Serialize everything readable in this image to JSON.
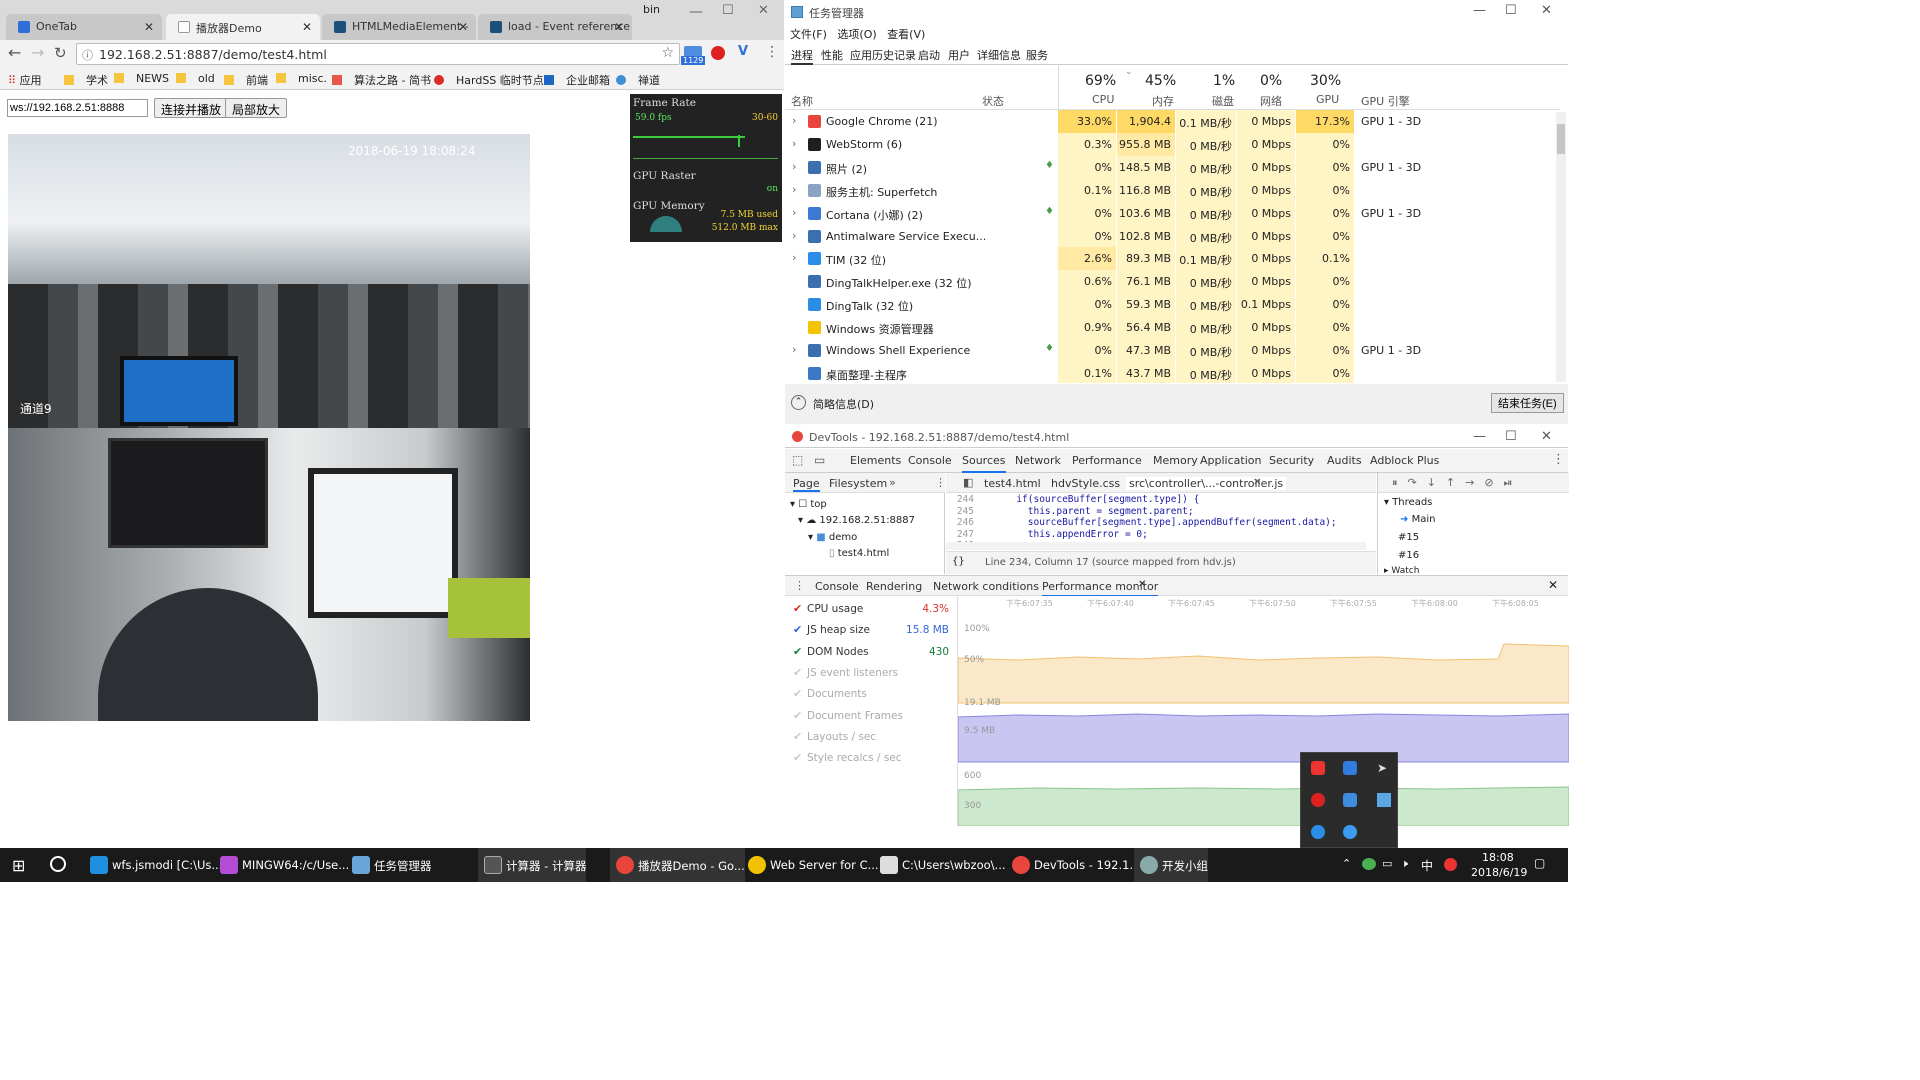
{
  "chrome": {
    "tabs": [
      {
        "label": "OneTab"
      },
      {
        "label": "播放器Demo"
      },
      {
        "label": "HTMLMediaElement -"
      },
      {
        "label": "load - Event reference"
      }
    ],
    "window_label": "bin",
    "address": "192.168.2.51:8887/demo/test4.html",
    "ext_badge": "1129",
    "bookmarks": [
      "应用",
      "学术",
      "NEWS",
      "old",
      "前端",
      "misc.",
      "算法之路 - 简书",
      "HardSS 临时节点",
      "企业邮箱",
      "禅道"
    ]
  },
  "page": {
    "ws_value": "ws://192.168.2.51:8888",
    "connect_button": "连接并播放",
    "zoom_button": "局部放大",
    "video1_timestamp": "2018-06-19 18:08:24",
    "video1_caption": "通道9"
  },
  "fps_meter": {
    "title": "Frame Rate",
    "fps": "59.0 fps",
    "range": "30-60",
    "raster_title": "GPU Raster",
    "raster_state": "on",
    "memory_title": "GPU Memory",
    "used": "7.5 MB used",
    "max": "512.0 MB max"
  },
  "task_manager": {
    "title": "任务管理器",
    "menu": [
      "文件(F)",
      "选项(O)",
      "查看(V)"
    ],
    "tabs": [
      "进程",
      "性能",
      "应用历史记录",
      "启动",
      "用户",
      "详细信息",
      "服务"
    ],
    "columns": {
      "name": "名称",
      "status": "状态",
      "cpu_pct": "69%",
      "cpu": "CPU",
      "mem_pct": "45%",
      "mem": "内存",
      "disk_pct": "1%",
      "disk": "磁盘",
      "net_pct": "0%",
      "net": "网络",
      "gpu_pct": "30%",
      "gpu": "GPU",
      "gpu_engine": "GPU 引擎"
    },
    "rows": [
      {
        "name": "Google Chrome (21)",
        "cpu": "33.0%",
        "mem": "1,904.4",
        "disk": "0.1 MB/秒",
        "net": "0 Mbps",
        "gpu": "17.3%",
        "engine": "GPU 1 - 3D"
      },
      {
        "name": "WebStorm (6)",
        "cpu": "0.3%",
        "mem": "955.8 MB",
        "disk": "0 MB/秒",
        "net": "0 Mbps",
        "gpu": "0%",
        "engine": ""
      },
      {
        "name": "照片 (2)",
        "cpu": "0%",
        "mem": "148.5 MB",
        "disk": "0 MB/秒",
        "net": "0 Mbps",
        "gpu": "0%",
        "engine": "GPU 1 - 3D"
      },
      {
        "name": "服务主机: Superfetch",
        "cpu": "0.1%",
        "mem": "116.8 MB",
        "disk": "0 MB/秒",
        "net": "0 Mbps",
        "gpu": "0%",
        "engine": ""
      },
      {
        "name": "Cortana (小娜) (2)",
        "cpu": "0%",
        "mem": "103.6 MB",
        "disk": "0 MB/秒",
        "net": "0 Mbps",
        "gpu": "0%",
        "engine": "GPU 1 - 3D"
      },
      {
        "name": "Antimalware Service Execu...",
        "cpu": "0%",
        "mem": "102.8 MB",
        "disk": "0 MB/秒",
        "net": "0 Mbps",
        "gpu": "0%",
        "engine": ""
      },
      {
        "name": "TIM (32 位)",
        "cpu": "2.6%",
        "mem": "89.3 MB",
        "disk": "0.1 MB/秒",
        "net": "0 Mbps",
        "gpu": "0.1%",
        "engine": ""
      },
      {
        "name": "DingTalkHelper.exe (32 位)",
        "cpu": "0.6%",
        "mem": "76.1 MB",
        "disk": "0 MB/秒",
        "net": "0 Mbps",
        "gpu": "0%",
        "engine": ""
      },
      {
        "name": "DingTalk (32 位)",
        "cpu": "0%",
        "mem": "59.3 MB",
        "disk": "0 MB/秒",
        "net": "0.1 Mbps",
        "gpu": "0%",
        "engine": ""
      },
      {
        "name": "Windows 资源管理器",
        "cpu": "0.9%",
        "mem": "56.4 MB",
        "disk": "0 MB/秒",
        "net": "0 Mbps",
        "gpu": "0%",
        "engine": ""
      },
      {
        "name": "Windows Shell Experience",
        "cpu": "0%",
        "mem": "47.3 MB",
        "disk": "0 MB/秒",
        "net": "0 Mbps",
        "gpu": "0%",
        "engine": "GPU 1 - 3D"
      },
      {
        "name": "桌面整理-主程序",
        "cpu": "0.1%",
        "mem": "43.7 MB",
        "disk": "0 MB/秒",
        "net": "0 Mbps",
        "gpu": "0%",
        "engine": ""
      }
    ],
    "fewer_details": "简略信息(D)",
    "end_task": "结束任务(E)"
  },
  "devtools": {
    "title": "DevTools - 192.168.2.51:8887/demo/test4.html",
    "tabs": [
      "Elements",
      "Console",
      "Sources",
      "Network",
      "Performance",
      "Memory",
      "Application",
      "Security",
      "Audits",
      "Adblock Plus"
    ],
    "nav_tabs": [
      "Page",
      "Filesystem"
    ],
    "tree": [
      "top",
      "192.168.2.51:8887",
      "demo",
      "test4.html"
    ],
    "file_tabs": [
      "test4.html",
      "hdvStyle.css",
      "src\\controller\\...-controller.js"
    ],
    "code_lines": [
      {
        "n": "244",
        "t": "      if(sourceBuffer[segment.type]) {"
      },
      {
        "n": "245",
        "t": "        this.parent = segment.parent;"
      },
      {
        "n": "246",
        "t": "        sourceBuffer[segment.type].appendBuffer(segment.data);"
      },
      {
        "n": "247",
        "t": "        this.appendError = 0;"
      },
      {
        "n": "248",
        "t": ""
      }
    ],
    "status_line": "Line 234, Column 17  (source mapped from hdv.js)",
    "threads_title": "Threads",
    "threads": [
      "Main",
      "#15",
      "#16"
    ],
    "watch": "Watch",
    "drawer_tabs": [
      "Console",
      "Rendering",
      "Network conditions",
      "Performance monitor"
    ],
    "metrics": [
      {
        "label": "CPU usage",
        "value": "4.3%",
        "color": "#d93025",
        "checked": true
      },
      {
        "label": "JS heap size",
        "value": "15.8 MB",
        "color": "#3367d6",
        "checked": true
      },
      {
        "label": "DOM Nodes",
        "value": "430",
        "color": "#188038",
        "checked": true
      },
      {
        "label": "JS event listeners",
        "value": "",
        "color": "#999",
        "checked": false
      },
      {
        "label": "Documents",
        "value": "",
        "color": "#999",
        "checked": false
      },
      {
        "label": "Document Frames",
        "value": "",
        "color": "#999",
        "checked": false
      },
      {
        "label": "Layouts / sec",
        "value": "",
        "color": "#999",
        "checked": false
      },
      {
        "label": "Style recalcs / sec",
        "value": "",
        "color": "#999",
        "checked": false
      }
    ],
    "time_ticks": [
      "下午6:07:35",
      "下午6:07:40",
      "下午6:07:45",
      "下午6:07:50",
      "下午6:07:55",
      "下午6:08:00",
      "下午6:08:05"
    ],
    "axis_labels": {
      "cpu100": "100%",
      "cpu50": "50%",
      "heap_top": "19.1 MB",
      "heap_mid": "9.5 MB",
      "dom600": "600",
      "dom300": "300"
    }
  },
  "taskbar": {
    "items": [
      "wfs.jsmodi [C:\\Us...",
      "MINGW64:/c/Use...",
      "任务管理器",
      "计算器 - 计算器",
      "播放器Demo - Go...",
      "Web Server for C...",
      "C:\\Users\\wbzoo\\...",
      "DevTools - 192.1...",
      "开发小组"
    ],
    "ime": "中",
    "time": "18:08",
    "date": "2018/6/19"
  }
}
